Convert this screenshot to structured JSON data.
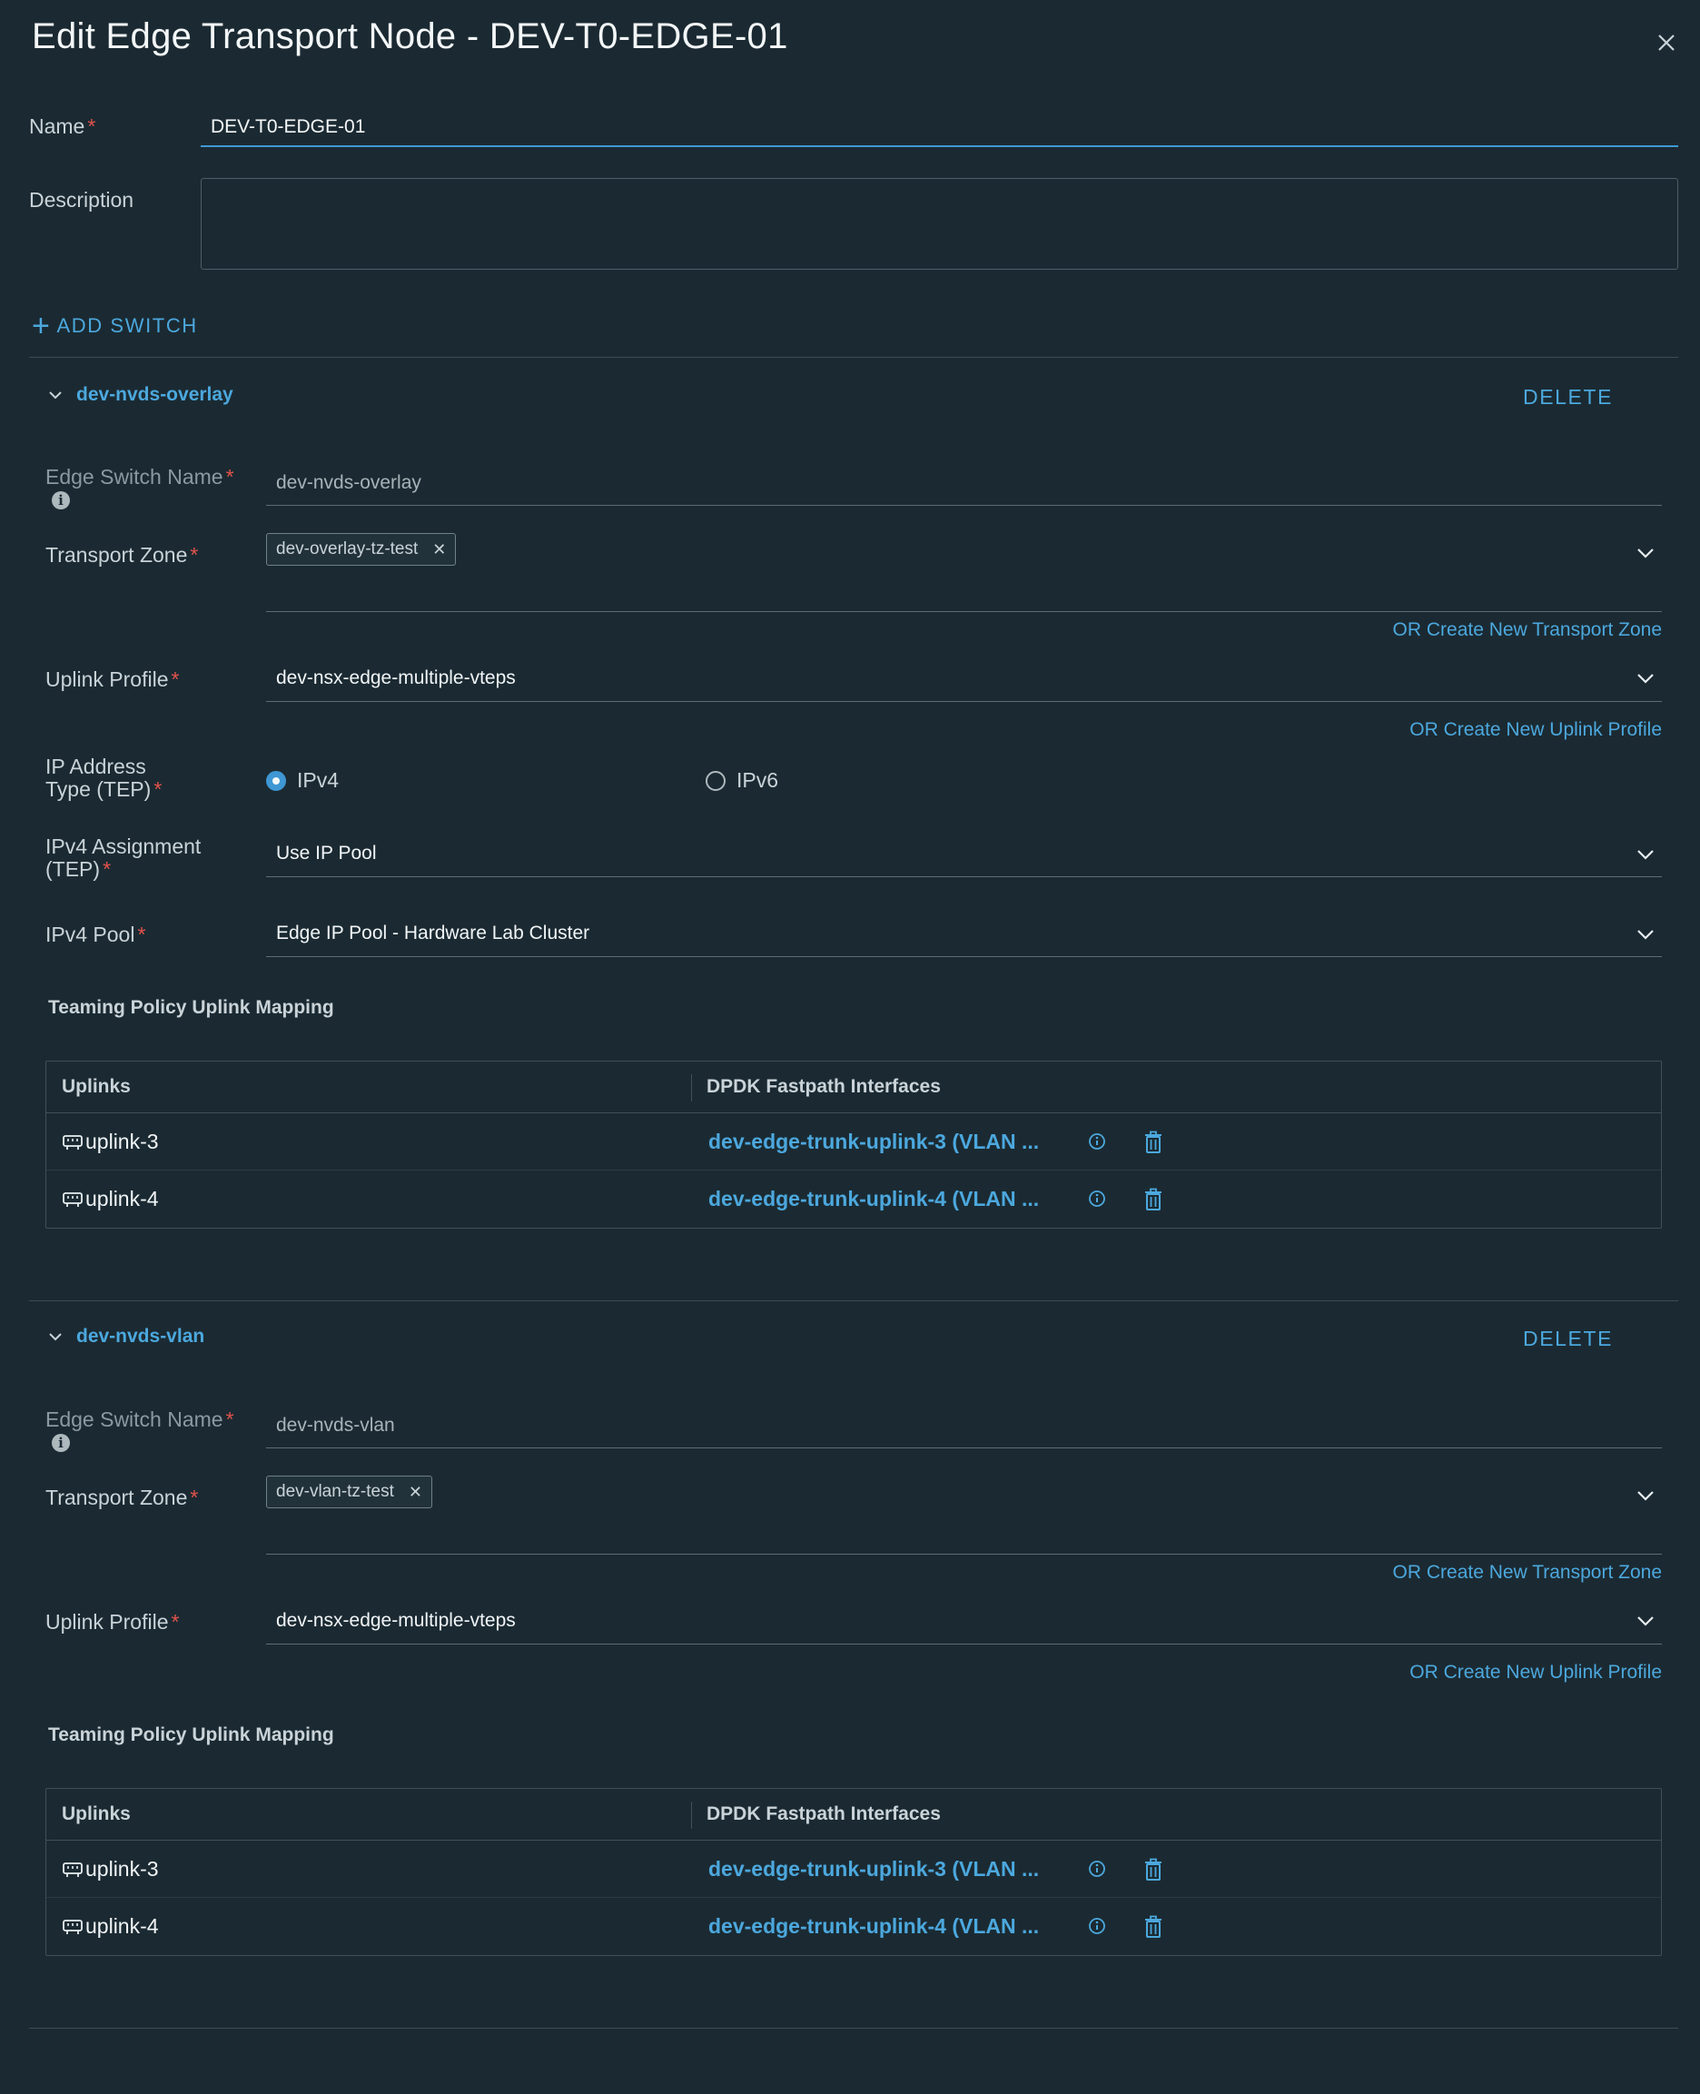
{
  "dialog": {
    "title": "Edit Edge Transport Node - DEV-T0-EDGE-01",
    "name_label": "Name",
    "name_value": "DEV-T0-EDGE-01",
    "description_label": "Description",
    "description_value": "",
    "add_switch_label": "ADD SWITCH",
    "required_marker": "*"
  },
  "colors": {
    "background": "#1b2a32",
    "accent": "#4ca8de",
    "required": "#e2524b"
  },
  "switches": [
    {
      "title": "dev-nvds-overlay",
      "delete_label": "DELETE",
      "edge_switch_name_label": "Edge Switch Name",
      "edge_switch_name_value": "dev-nvds-overlay",
      "transport_zone_label": "Transport Zone",
      "transport_zone_value": "dev-overlay-tz-test",
      "create_tz_link": "OR Create New Transport Zone",
      "uplink_profile_label": "Uplink Profile",
      "uplink_profile_value": "dev-nsx-edge-multiple-vteps",
      "create_up_link": "OR Create New Uplink Profile",
      "ip_type_label_1": "IP Address",
      "ip_type_label_2": "Type (TEP)",
      "ip_type_options": [
        "IPv4",
        "IPv6"
      ],
      "ip_type_selected": "IPv4",
      "ipv4_assign_label_1": "IPv4 Assignment",
      "ipv4_assign_label_2": "(TEP)",
      "ipv4_assign_value": "Use IP Pool",
      "ipv4_pool_label": "IPv4 Pool",
      "ipv4_pool_value": "Edge IP Pool - Hardware Lab Cluster",
      "teaming_label": "Teaming Policy Uplink Mapping",
      "table_headers": [
        "Uplinks",
        "DPDK Fastpath Interfaces"
      ],
      "rows": [
        {
          "uplink": "uplink-3",
          "interface": "dev-edge-trunk-uplink-3 (VLAN ..."
        },
        {
          "uplink": "uplink-4",
          "interface": "dev-edge-trunk-uplink-4 (VLAN ..."
        }
      ]
    },
    {
      "title": "dev-nvds-vlan",
      "delete_label": "DELETE",
      "edge_switch_name_label": "Edge Switch Name",
      "edge_switch_name_value": "dev-nvds-vlan",
      "transport_zone_label": "Transport Zone",
      "transport_zone_value": "dev-vlan-tz-test",
      "create_tz_link": "OR Create New Transport Zone",
      "uplink_profile_label": "Uplink Profile",
      "uplink_profile_value": "dev-nsx-edge-multiple-vteps",
      "create_up_link": "OR Create New Uplink Profile",
      "teaming_label": "Teaming Policy Uplink Mapping",
      "table_headers": [
        "Uplinks",
        "DPDK Fastpath Interfaces"
      ],
      "rows": [
        {
          "uplink": "uplink-3",
          "interface": "dev-edge-trunk-uplink-3 (VLAN ..."
        },
        {
          "uplink": "uplink-4",
          "interface": "dev-edge-trunk-uplink-4 (VLAN ..."
        }
      ]
    }
  ]
}
